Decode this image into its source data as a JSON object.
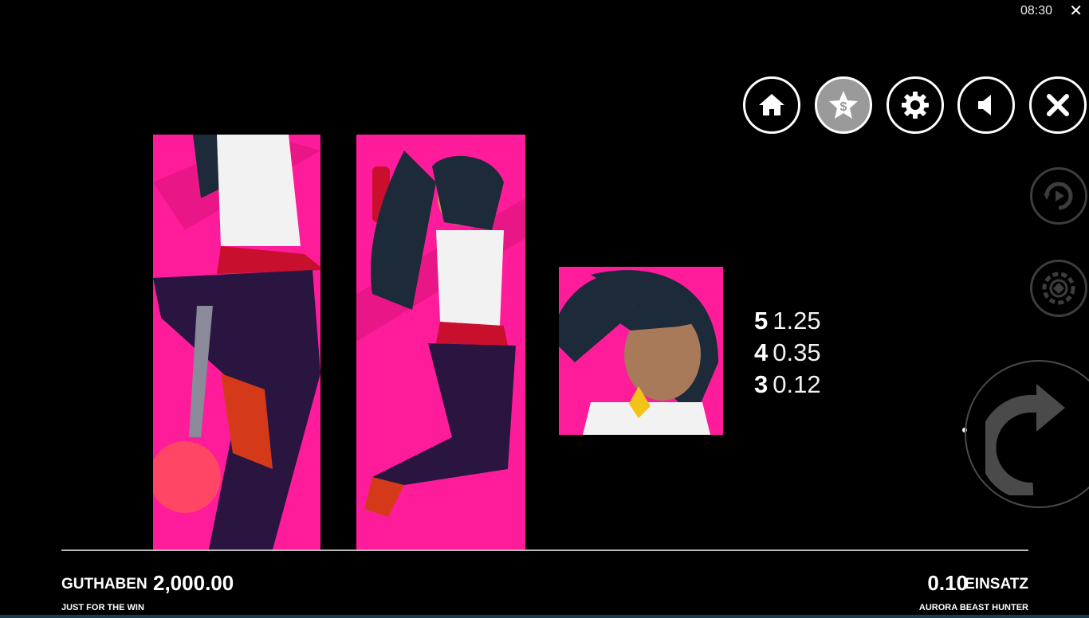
{
  "status_bar": {
    "time": "08:30",
    "close_glyph": "✕"
  },
  "nav_buttons": [
    {
      "name": "home-button",
      "icon": "home-icon",
      "active": false
    },
    {
      "name": "paytable-button",
      "icon": "star-dollar-icon",
      "active": true
    },
    {
      "name": "settings-button",
      "icon": "gear-icon",
      "active": false
    },
    {
      "name": "sound-button",
      "icon": "speaker-icon",
      "active": false
    },
    {
      "name": "close-button",
      "icon": "close-icon",
      "active": false
    }
  ],
  "side_controls": [
    {
      "name": "autoplay-button",
      "icon": "autoplay-icon"
    },
    {
      "name": "bet-chip-button",
      "icon": "chip-icon"
    },
    {
      "name": "spin-button",
      "icon": "spin-arrow-icon"
    }
  ],
  "symbols": [
    {
      "name": "character-full-body-panel-1",
      "color": "#ff1c9a"
    },
    {
      "name": "character-full-body-panel-2",
      "color": "#ff1c9a"
    },
    {
      "name": "character-portrait-symbol",
      "color": "#ff1c9a"
    }
  ],
  "paytable": [
    {
      "count": "5",
      "value": "1.25"
    },
    {
      "count": "4",
      "value": "0.35"
    },
    {
      "count": "3",
      "value": "0.12"
    }
  ],
  "footer": {
    "balance_label": "GUTHABEN",
    "balance_value": "2,000.00",
    "bet_value": "0.10",
    "bet_label": "EINSATZ",
    "tagline": "JUST FOR THE WIN",
    "game_name": "AURORA BEAST HUNTER"
  }
}
